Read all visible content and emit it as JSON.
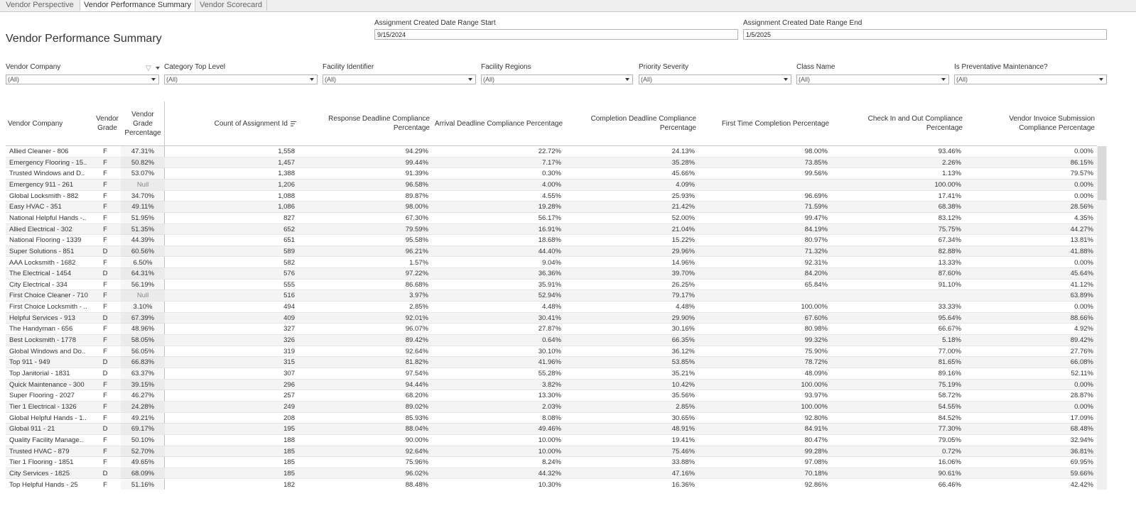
{
  "tabs": [
    {
      "label": "Vendor Perspective"
    },
    {
      "label": "Vendor Performance Summary"
    },
    {
      "label": "Vendor Scorecard"
    }
  ],
  "page_title": "Vendor Performance Summary",
  "date_range": {
    "start_label": "Assignment Created Date Range Start",
    "start_value": "9/15/2024",
    "end_label": "Assignment Created Date Range End",
    "end_value": "1/5/2025"
  },
  "filters": [
    {
      "label": "Vendor Company",
      "value": "(All)"
    },
    {
      "label": "Category Top Level",
      "value": "(All)"
    },
    {
      "label": "Facility Identifier",
      "value": "(All)"
    },
    {
      "label": "Facility Regions",
      "value": "(All)"
    },
    {
      "label": "Priority Severity",
      "value": "(All)"
    },
    {
      "label": "Class Name",
      "value": "(All)"
    },
    {
      "label": "Is Preventative Maintenance?",
      "value": "(All)"
    }
  ],
  "table": {
    "columns": [
      "Vendor Company",
      "Vendor Grade",
      "Vendor Grade Percentage",
      "Count of Assignment Id",
      "Response Deadline Compliance Percentage",
      "Arrival Deadline Compliance Percentage",
      "Completion Deadline Compliance Percentage",
      "First Time Completion Percentage",
      "Check In and Out Compliance Percentage",
      "Vendor Invoice Submission Compliance Percentage"
    ],
    "rows": [
      [
        "Allied Cleaner - 806",
        "F",
        "47.31%",
        "1,558",
        "94.29%",
        "22.72%",
        "24.13%",
        "98.00%",
        "93.46%",
        "0.00%"
      ],
      [
        "Emergency Flooring - 15..",
        "F",
        "50.82%",
        "1,457",
        "99.44%",
        "7.17%",
        "35.28%",
        "73.85%",
        "2.26%",
        "86.15%"
      ],
      [
        "Trusted Windows and D..",
        "F",
        "53.07%",
        "1,388",
        "91.39%",
        "0.30%",
        "45.66%",
        "99.56%",
        "1.13%",
        "79.57%"
      ],
      [
        "Emergency 911 - 261",
        "F",
        "Null",
        "1,206",
        "96.58%",
        "4.00%",
        "4.09%",
        "",
        "100.00%",
        "0.00%"
      ],
      [
        "Global Locksmith - 882",
        "F",
        "34.70%",
        "1,088",
        "89.87%",
        "4.55%",
        "25.93%",
        "96.69%",
        "17.41%",
        "0.00%"
      ],
      [
        "Easy HVAC - 351",
        "F",
        "49.11%",
        "1,086",
        "98.00%",
        "19.28%",
        "21.42%",
        "71.59%",
        "68.38%",
        "28.56%"
      ],
      [
        "National Helpful Hands -..",
        "F",
        "51.95%",
        "827",
        "67.30%",
        "56.17%",
        "52.00%",
        "99.47%",
        "83.12%",
        "4.35%"
      ],
      [
        "Allied Electrical - 302",
        "F",
        "51.35%",
        "652",
        "79.59%",
        "16.91%",
        "21.04%",
        "84.19%",
        "75.75%",
        "44.27%"
      ],
      [
        "National Flooring - 1339",
        "F",
        "44.39%",
        "651",
        "95.58%",
        "18.68%",
        "15.22%",
        "80.97%",
        "67.34%",
        "13.81%"
      ],
      [
        "Super Solutions - 851",
        "D",
        "60.56%",
        "589",
        "96.21%",
        "44.40%",
        "29.96%",
        "71.32%",
        "82.88%",
        "41.88%"
      ],
      [
        "AAA Locksmith - 1682",
        "F",
        "6.50%",
        "582",
        "1.57%",
        "9.04%",
        "14.96%",
        "92.31%",
        "13.33%",
        "0.00%"
      ],
      [
        "The Electrical - 1454",
        "D",
        "64.31%",
        "576",
        "97.22%",
        "36.36%",
        "39.70%",
        "84.20%",
        "87.60%",
        "45.64%"
      ],
      [
        "City Electrical - 334",
        "F",
        "56.19%",
        "555",
        "86.68%",
        "35.91%",
        "26.25%",
        "65.84%",
        "91.10%",
        "41.12%"
      ],
      [
        "First Choice Cleaner - 710",
        "F",
        "Null",
        "516",
        "3.97%",
        "52.94%",
        "79.17%",
        "",
        "",
        "63.89%"
      ],
      [
        "First Choice Locksmith - ..",
        "F",
        "3.10%",
        "494",
        "2.85%",
        "4.48%",
        "4.48%",
        "100.00%",
        "33.33%",
        "0.00%"
      ],
      [
        "Helpful Services - 913",
        "D",
        "67.39%",
        "409",
        "92.01%",
        "30.41%",
        "29.90%",
        "67.60%",
        "95.64%",
        "88.66%"
      ],
      [
        "The Handyman - 656",
        "F",
        "48.96%",
        "327",
        "96.07%",
        "27.87%",
        "30.16%",
        "80.98%",
        "66.67%",
        "4.92%"
      ],
      [
        "Best Locksmith - 1778",
        "F",
        "58.05%",
        "326",
        "89.42%",
        "0.64%",
        "66.35%",
        "99.32%",
        "5.18%",
        "89.42%"
      ],
      [
        "Global Windows and Do..",
        "F",
        "56.05%",
        "319",
        "92.64%",
        "30.10%",
        "36.12%",
        "75.90%",
        "77.00%",
        "27.76%"
      ],
      [
        "Top 911 - 949",
        "D",
        "66.83%",
        "315",
        "81.82%",
        "41.96%",
        "53.85%",
        "78.72%",
        "81.65%",
        "66.08%"
      ],
      [
        "Top Janitorial - 1831",
        "D",
        "63.37%",
        "307",
        "97.54%",
        "55.28%",
        "35.21%",
        "48.09%",
        "89.16%",
        "52.11%"
      ],
      [
        "Quick Maintenance - 300",
        "F",
        "39.15%",
        "296",
        "94.44%",
        "3.82%",
        "10.42%",
        "100.00%",
        "75.19%",
        "0.00%"
      ],
      [
        "Super Flooring - 2027",
        "F",
        "46.27%",
        "257",
        "68.20%",
        "13.30%",
        "35.56%",
        "93.97%",
        "58.72%",
        "28.87%"
      ],
      [
        "Tier 1 Electrical - 1326",
        "F",
        "24.28%",
        "249",
        "89.02%",
        "2.03%",
        "2.85%",
        "100.00%",
        "54.55%",
        "0.00%"
      ],
      [
        "Global Helpful Hands - 1..",
        "F",
        "49.21%",
        "208",
        "85.93%",
        "8.08%",
        "30.65%",
        "92.80%",
        "84.52%",
        "17.09%"
      ],
      [
        "Global 911 - 21",
        "D",
        "69.17%",
        "195",
        "88.04%",
        "49.46%",
        "48.91%",
        "84.91%",
        "77.30%",
        "68.48%"
      ],
      [
        "Quality Facility Manage..",
        "F",
        "50.10%",
        "188",
        "90.00%",
        "10.00%",
        "19.41%",
        "80.47%",
        "79.05%",
        "32.94%"
      ],
      [
        "Trusted HVAC - 879",
        "F",
        "52.70%",
        "185",
        "92.64%",
        "10.00%",
        "75.46%",
        "99.28%",
        "0.72%",
        "36.81%"
      ],
      [
        "Tier 1 Flooring - 1851",
        "F",
        "49.65%",
        "185",
        "75.96%",
        "8.24%",
        "33.88%",
        "97.08%",
        "16.06%",
        "69.95%"
      ],
      [
        "City Services - 1825",
        "D",
        "68.09%",
        "185",
        "96.02%",
        "44.32%",
        "47.16%",
        "70.18%",
        "90.61%",
        "59.66%"
      ],
      [
        "Top Helpful Hands - 25",
        "F",
        "51.16%",
        "182",
        "88.48%",
        "10.30%",
        "16.36%",
        "92.86%",
        "66.46%",
        "42.42%"
      ]
    ]
  }
}
